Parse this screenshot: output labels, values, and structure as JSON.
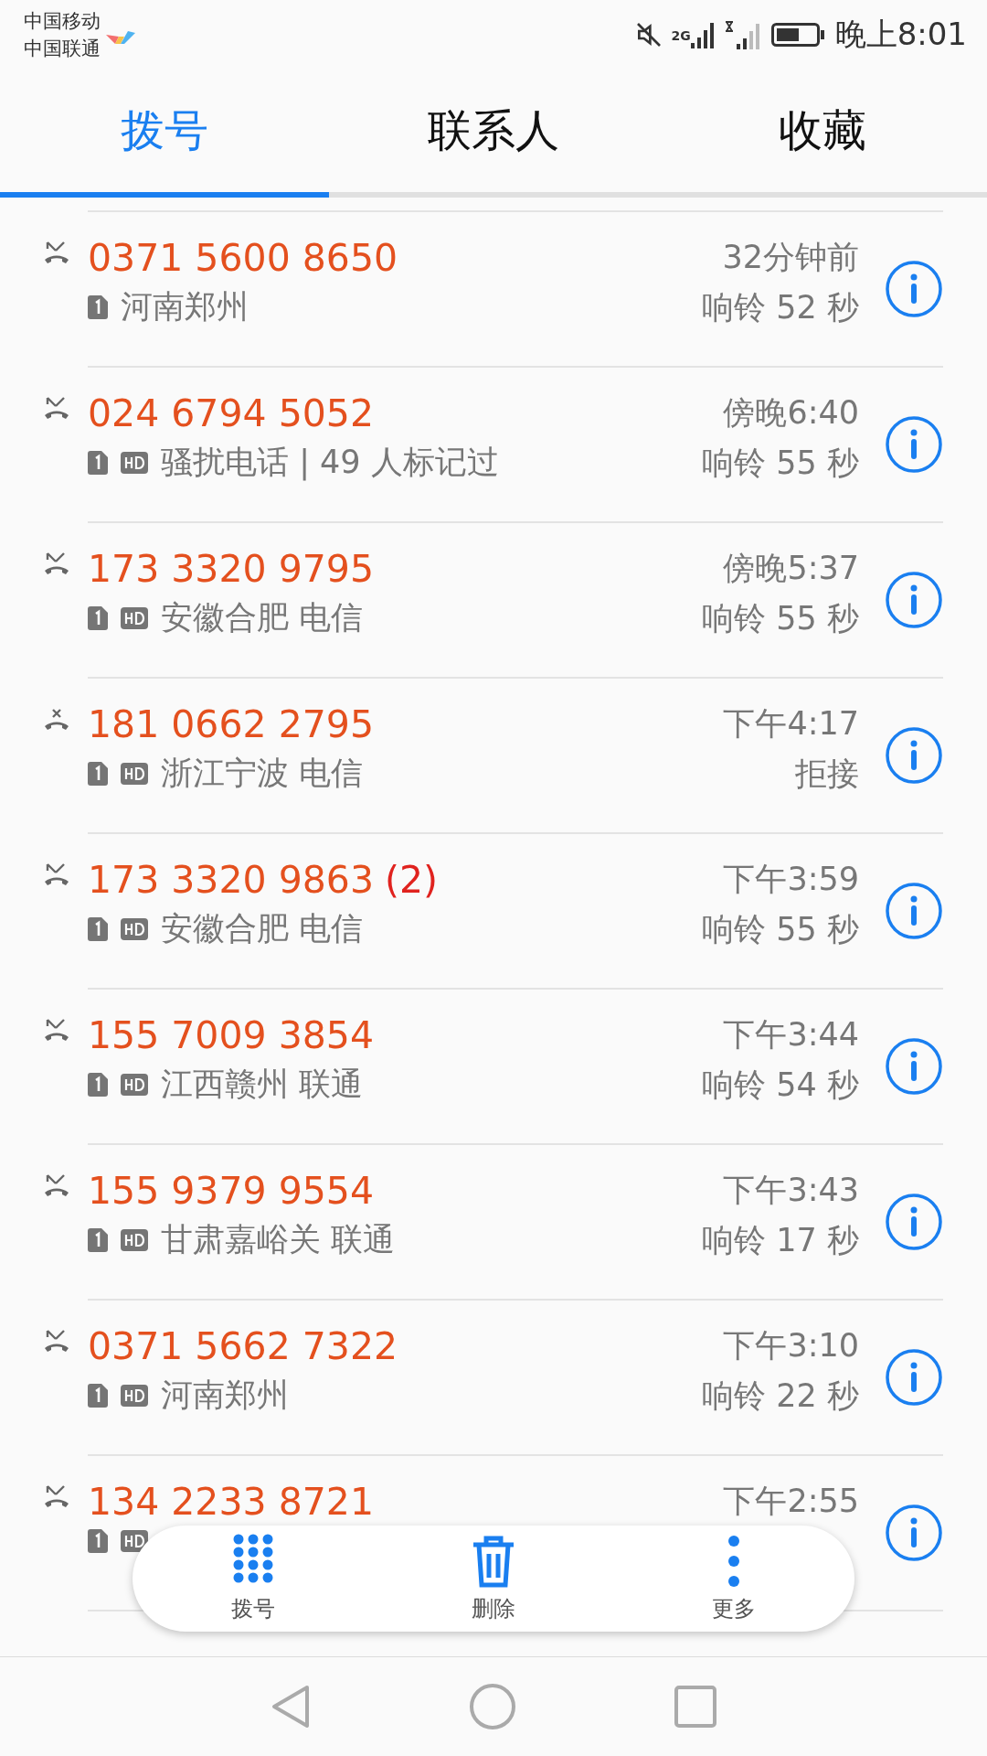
{
  "status_bar": {
    "carriers": [
      "中国移动",
      "中国联通"
    ],
    "network": "2G",
    "time": "晚上8:01"
  },
  "tabs": [
    {
      "label": "拨号",
      "selected": true
    },
    {
      "label": "联系人",
      "selected": false
    },
    {
      "label": "收藏",
      "selected": false
    }
  ],
  "calls": [
    {
      "kind": "missed",
      "number": "0371 5600 8650",
      "hd": false,
      "location": "河南郑州",
      "time": "32分钟前",
      "detail": "响铃 52 秒"
    },
    {
      "kind": "missed",
      "number": "024 6794 5052",
      "hd": true,
      "location": "骚扰电话 | 49 人标记过",
      "time": "傍晚6:40",
      "detail": "响铃 55 秒"
    },
    {
      "kind": "missed",
      "number": "173 3320 9795",
      "hd": true,
      "location": "安徽合肥 电信",
      "time": "傍晚5:37",
      "detail": "响铃 55 秒"
    },
    {
      "kind": "rejected",
      "number": "181 0662 2795",
      "hd": true,
      "location": "浙江宁波 电信",
      "time": "下午4:17",
      "detail": "拒接"
    },
    {
      "kind": "missed",
      "number": "173 3320 9863",
      "count": "(2)",
      "hd": true,
      "location": "安徽合肥 电信",
      "time": "下午3:59",
      "detail": "响铃 55 秒"
    },
    {
      "kind": "missed",
      "number": "155 7009 3854",
      "hd": true,
      "location": "江西赣州 联通",
      "time": "下午3:44",
      "detail": "响铃 54 秒"
    },
    {
      "kind": "missed",
      "number": "155 9379 9554",
      "hd": true,
      "location": "甘肃嘉峪关 联通",
      "time": "下午3:43",
      "detail": "响铃 17 秒"
    },
    {
      "kind": "missed",
      "number": "0371 5662 7322",
      "hd": true,
      "location": "河南郑州",
      "time": "下午3:10",
      "detail": "响铃 22 秒"
    },
    {
      "kind": "missed",
      "number": "134 2233 8721",
      "hd": true,
      "time": "下午2:55"
    }
  ],
  "toolbar": [
    {
      "kind": "dialpad",
      "label": "拨号"
    },
    {
      "kind": "delete",
      "label": "删除"
    },
    {
      "kind": "more",
      "label": "更多"
    }
  ]
}
